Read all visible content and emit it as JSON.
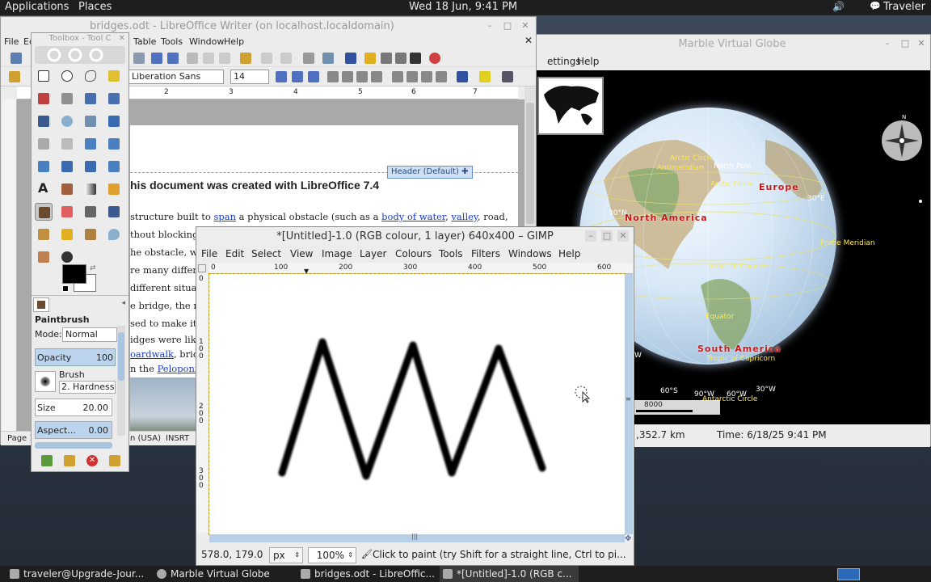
{
  "top_panel": {
    "applications": "Applications",
    "places": "Places",
    "clock": "Wed 18 Jun,  9:41 PM",
    "user": "Traveler"
  },
  "marble": {
    "title": "Marble Virtual Globe",
    "menu": [
      "ettings",
      "Help"
    ],
    "labels": {
      "north_pole": "North Pole",
      "arctic_circle": "Arctic Circle",
      "antimeridian": "Antimeridian",
      "arctic_circle2": "Arctic Circle",
      "europe": "Europe",
      "north_america": "North America",
      "south_america": "South America",
      "prime_meridian": "Prime Meridian",
      "tropic_cancer": "Tropic of Cancer",
      "equator": "Equator",
      "tropic_capricorn": "Tropic of Capricorn",
      "antarctic_circle": "Antarctic Circle",
      "lat30n": "30°N",
      "lon30e": "30°E",
      "lat60s": "60°S",
      "lon90w": "90°W",
      "lon60w": "60°W",
      "lon30w": "30°W",
      "w": "W"
    },
    "scale_label": "8000",
    "status_distance": ",352.7 km",
    "status_time": "Time: 6/18/25 9:41 PM"
  },
  "writer": {
    "title": "bridges.odt - LibreOffice Writer (on localhost.localdomain)",
    "menu": [
      "File",
      "Ed",
      "Table",
      "Tools",
      "Window",
      "Help"
    ],
    "font_name": "Liberation Sans",
    "font_size": "14",
    "ruler": [
      "2",
      "3",
      "4",
      "5",
      "6",
      "7"
    ],
    "header_tag": "Header (Default)",
    "heading": "his document was created with LibreOffice 7.4",
    "lines": [
      {
        "pre": "structure built to ",
        "link1": "span",
        "mid": " a physical obstacle (such as a ",
        "link2": "body of water",
        "mid2": ", ",
        "link3": "valley",
        "post": ", road,"
      },
      {
        "text": "thout blocking t"
      },
      {
        "text": "he obstacle, whi"
      },
      {
        "text": "re many differe"
      },
      {
        "text": "different situati"
      },
      {
        "text": "e bridge, the natu"
      },
      {
        "text": "sed to make it, a"
      },
      {
        "text": "idges were likel"
      },
      {
        "link": "oardwalk",
        "post": ", bridge"
      },
      {
        "pre": "n the ",
        "link": "Peloponnes"
      }
    ],
    "status_page": "Page 1",
    "status_lang": "n (USA)",
    "status_insrt": "INSRT"
  },
  "toolbox": {
    "title": "Toolbox - Tool C",
    "tool_name": "Paintbrush",
    "mode_label": "Mode:",
    "mode_value": "Normal",
    "opacity_label": "Opacity",
    "opacity_value": "100",
    "brush_label": "Brush",
    "brush_value": "2. Hardness",
    "size_label": "Size",
    "size_value": "20.00",
    "aspect_label": "Aspect...",
    "aspect_value": "0.00"
  },
  "gimp": {
    "title": "*[Untitled]-1.0 (RGB colour, 1 layer) 640x400 – GIMP",
    "menu": [
      "File",
      "Edit",
      "Select",
      "View",
      "Image",
      "Layer",
      "Colours",
      "Tools",
      "Filters",
      "Windows",
      "Help"
    ],
    "hruler": [
      "0",
      "100",
      "200",
      "300",
      "400",
      "500",
      "600"
    ],
    "vruler": [
      "0",
      "1\n0\n0",
      "2\n0\n0",
      "3\n0\n0"
    ],
    "coords": "578.0, 179.0",
    "unit": "px",
    "zoom": "100%",
    "hint": "Click to paint (try Shift for a straight line, Ctrl to pi..."
  },
  "taskbar": {
    "items": [
      "traveler@Upgrade-Jour...",
      "Marble Virtual Globe",
      "bridges.odt - LibreOffic...",
      "*[Untitled]-1.0 (RGB c..."
    ]
  }
}
